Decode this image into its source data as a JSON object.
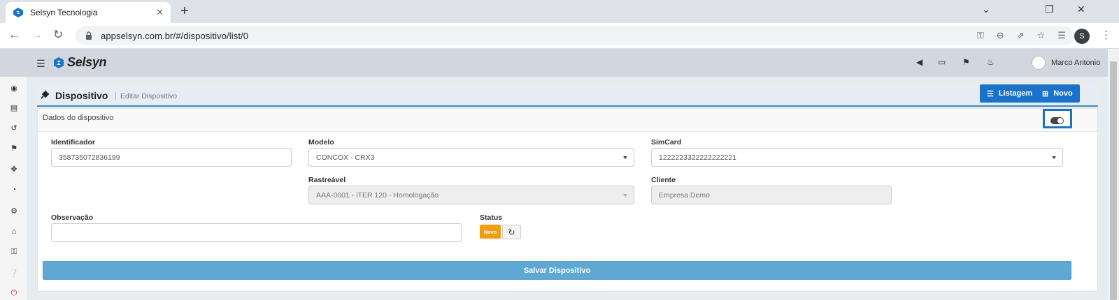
{
  "browser": {
    "tab_title": "Selsyn Tecnologia",
    "tab_close": "✕",
    "new_tab": "+",
    "url": "appselsyn.com.br/#/dispositivo/list/0",
    "profile_initial": "S",
    "minimize": "⌄",
    "restore": "❐",
    "close": "✕"
  },
  "app": {
    "brand": "Selsyn",
    "user_name": "Marco Antonio",
    "accent_color": "#1a73c8"
  },
  "page": {
    "title": "Dispositivo",
    "subtitle": "Editar Dispositivo",
    "list_button": "Listagem",
    "new_button": "Novo",
    "section_title": "Dados do dispositivo"
  },
  "form": {
    "identificador_label": "Identificador",
    "identificador_value": "358735072836199",
    "modelo_label": "Modelo",
    "modelo_value": "CONCOX - CRX3",
    "simcard_label": "SimCard",
    "simcard_value": "1222223322222222221",
    "rastreavel_label": "Rastreável",
    "rastreavel_value": "AAA-0001 - iTER 120 - Homologação",
    "cliente_label": "Cliente",
    "cliente_value": "Empresa Demo",
    "observacao_label": "Observação",
    "observacao_value": "",
    "status_label": "Status",
    "status_value": "Novo",
    "status_color": "#f39c12",
    "save_button": "Salvar Dispositivo"
  },
  "icons": {
    "sidebar": [
      "dashboard-icon",
      "map-icon",
      "history-icon",
      "bullhorn-icon",
      "crosshairs-icon",
      "pie-chart-icon",
      "cogs-icon",
      "bank-icon",
      "key-icon",
      "question-icon",
      "power-icon"
    ]
  }
}
